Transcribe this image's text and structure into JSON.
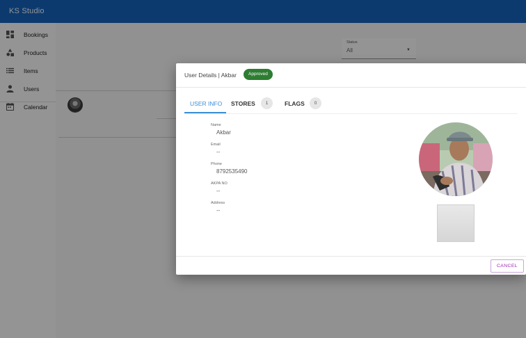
{
  "app": {
    "title": "KS Studio",
    "brand_color": "#1565c0"
  },
  "sidebar": {
    "items": [
      {
        "label": "Bookings",
        "icon": "dashboard-icon"
      },
      {
        "label": "Products",
        "icon": "category-icon"
      },
      {
        "label": "Items",
        "icon": "list-icon"
      },
      {
        "label": "Users",
        "icon": "person-icon"
      },
      {
        "label": "Calendar",
        "icon": "calendar-icon"
      }
    ]
  },
  "filter": {
    "status_label": "Status",
    "status_value": "All"
  },
  "dialog": {
    "title": "User Details | Akbar",
    "status_badge": "Approved",
    "badge_color": "#2e7d32",
    "accent_color": "#3a8fd6",
    "tabs": [
      {
        "label": "USER INFO",
        "active": true
      },
      {
        "label": "STORES",
        "count": "1"
      },
      {
        "label": "FLAGS",
        "count": "0"
      }
    ],
    "fields": [
      {
        "label": "Name",
        "value": "Akbar"
      },
      {
        "label": "Email",
        "value": "--"
      },
      {
        "label": "Phone",
        "value": "8792535490"
      },
      {
        "label": "AKPA NO",
        "value": "--"
      },
      {
        "label": "Address",
        "value": "--"
      }
    ],
    "cancel_label": "CANCEL"
  }
}
